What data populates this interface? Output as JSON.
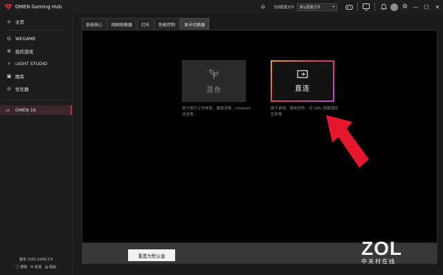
{
  "app": {
    "title": "OMEN Gaming Hub"
  },
  "titlebar": {
    "profile_label": "当前配置文件",
    "profile_value": "默认配置文件",
    "profile_arrow": "▾",
    "icons": [
      "home-icon",
      "gamepad-icon",
      "screen-icon",
      "bell-icon",
      "avatar",
      "settings-icon"
    ],
    "minimize": "—",
    "maximize": "☐",
    "close": "✕"
  },
  "sidebar": {
    "items": [
      {
        "label": "主页",
        "icon": "home-icon"
      },
      {
        "label": "WEGAME",
        "icon": "wegame-icon"
      },
      {
        "label": "我的游戏",
        "icon": "library-icon"
      },
      {
        "label": "LIGHT STUDIO",
        "icon": "light-icon"
      },
      {
        "label": "图库",
        "icon": "gallery-icon"
      },
      {
        "label": "优化器",
        "icon": "optimizer-icon"
      }
    ],
    "device": {
      "label": "OMEN 16",
      "icon": "laptop-icon"
    },
    "version": "版本 1101.2209.2.0",
    "footer": {
      "help": "帮助",
      "feedback": "反馈",
      "privacy": "隐私"
    }
  },
  "tabs": [
    {
      "label": "系统核心",
      "active": false
    },
    {
      "label": "网络助推器",
      "active": false
    },
    {
      "label": "灯光",
      "active": false
    },
    {
      "label": "性能控制",
      "active": false
    },
    {
      "label": "显卡切换器",
      "active": true
    }
  ],
  "modes": {
    "mixed": {
      "label": "混合",
      "desc": "用于提升工作效率、媒体消费、Internet 浏览等。"
    },
    "direct": {
      "label": "直连",
      "desc": "用于游戏、媒体创作，对 GPU 较敏感的任务等"
    }
  },
  "actions": {
    "reset": "重置为默认值"
  },
  "watermark": {
    "brand": "ZOL",
    "sub": "中关村在线"
  },
  "colors": {
    "accent": "#c9283e",
    "arrow": "#e4172c",
    "border_gradient": [
      "#e8a23a",
      "#d23c6a",
      "#b64bd8"
    ]
  }
}
